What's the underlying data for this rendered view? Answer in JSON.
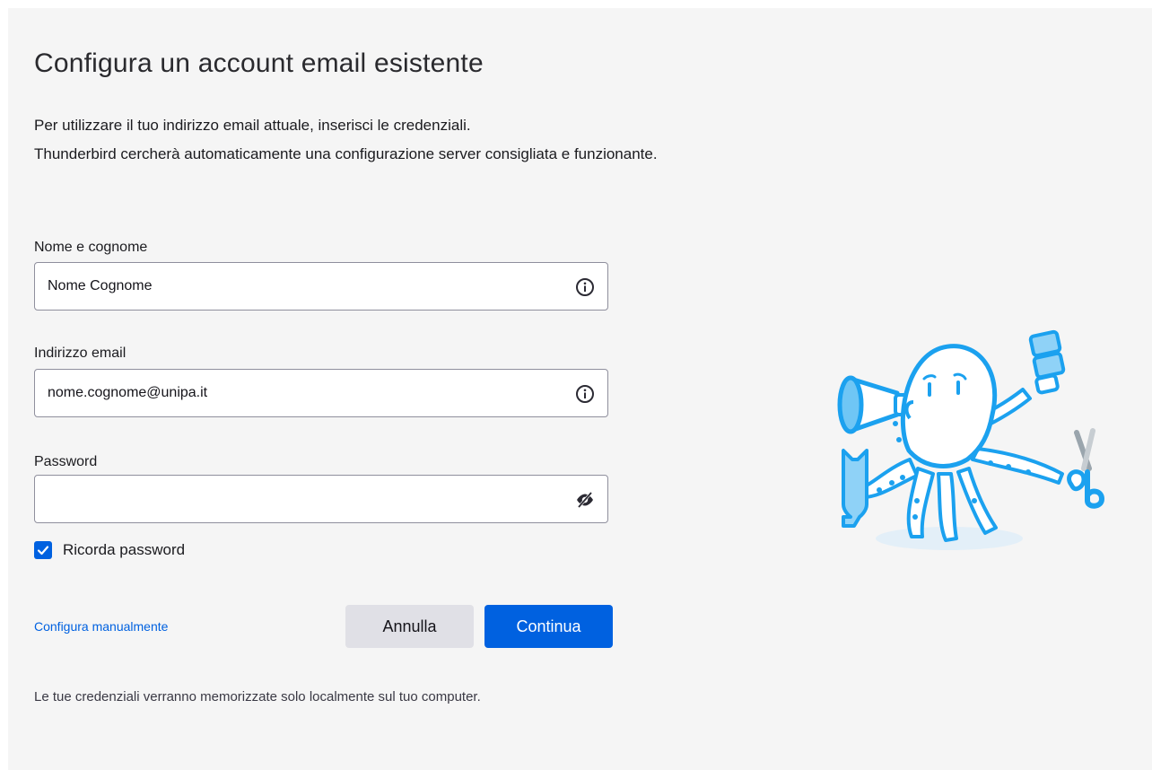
{
  "header": {
    "title": "Configura un account email esistente",
    "description_line1": "Per utilizzare il tuo indirizzo email attuale, inserisci le credenziali.",
    "description_line2": "Thunderbird cercherà automaticamente una configurazione server consigliata e funzionante."
  },
  "form": {
    "name": {
      "label": "Nome e cognome",
      "value": "Nome Cognome",
      "icon": "info-icon"
    },
    "email": {
      "label": "Indirizzo email",
      "value": "nome.cognome@unipa.it",
      "icon": "info-icon"
    },
    "password": {
      "label": "Password",
      "value": "",
      "icon": "eye-slash-icon"
    },
    "remember": {
      "label": "Ricorda password",
      "checked": true
    }
  },
  "actions": {
    "manual_link": "Configura manualmente",
    "cancel_label": "Annulla",
    "continue_label": "Continua"
  },
  "footer": {
    "note": "Le tue credenziali verranno memorizzate solo localmente sul tuo computer."
  },
  "colors": {
    "accent": "#0061e0",
    "panel_bg": "#f5f5f5",
    "mascot_blue": "#1ba1ef"
  }
}
